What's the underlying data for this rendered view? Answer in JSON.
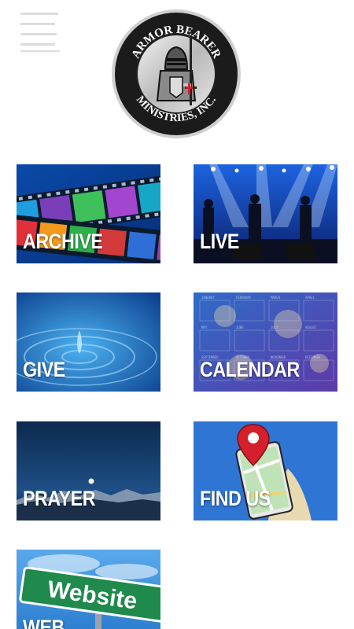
{
  "header": {
    "logo": {
      "top_text": "ARMOR BEARER",
      "bottom_text": "MINISTRIES, INC."
    }
  },
  "tiles": [
    {
      "label": "ARCHIVE"
    },
    {
      "label": "LIVE"
    },
    {
      "label": "GIVE"
    },
    {
      "label": "CALENDAR"
    },
    {
      "label": "PRAYER"
    },
    {
      "label": "FIND US"
    },
    {
      "label": "WEB",
      "sign_text": "Website"
    }
  ],
  "calendar_months": [
    "JANUARY",
    "FEBRUARY",
    "MARCH",
    "APRIL",
    "MAY",
    "JUNE",
    "JULY",
    "AUGUST",
    "SEPTEMBER",
    "OCTOBER",
    "NOVEMBER",
    "DECEMBER"
  ],
  "colors": {
    "accent_red": "#d4202a",
    "logo_ring": "#1b1b1b",
    "tile_blue": "#1a5fb4"
  }
}
